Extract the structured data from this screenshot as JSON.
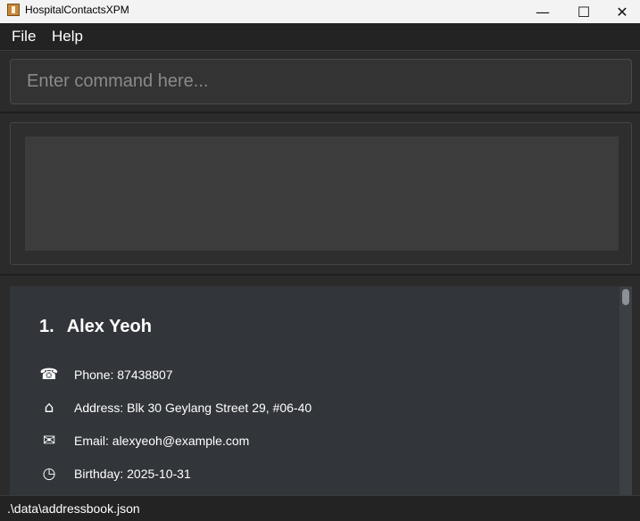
{
  "window": {
    "title": "HospitalContactsXPM",
    "minimize_glyph": "—",
    "maximize_glyph": "☐",
    "close_glyph": "✕"
  },
  "menu": {
    "items": [
      "File",
      "Help"
    ]
  },
  "command": {
    "placeholder": "Enter command here...",
    "value": ""
  },
  "result": {
    "text": ""
  },
  "persons": [
    {
      "index": "1.",
      "name": "Alex Yeoh",
      "fields": [
        {
          "icon": "telephone-icon",
          "glyph": "☎",
          "text": "Phone: 87438807"
        },
        {
          "icon": "home-icon",
          "glyph": "⌂",
          "text": "Address: Blk 30 Geylang Street 29, #06-40"
        },
        {
          "icon": "envelope-icon",
          "glyph": "✉",
          "text": "Email: alexyeoh@example.com"
        },
        {
          "icon": "clock-icon",
          "glyph": "◷",
          "text": "Birthday: 2025-10-31"
        }
      ]
    }
  ],
  "status": {
    "file_path": ".\\data\\addressbook.json"
  },
  "colors": {
    "background": "#2b2b2b",
    "card": "#323539",
    "result_box": "#3c3c3c"
  }
}
